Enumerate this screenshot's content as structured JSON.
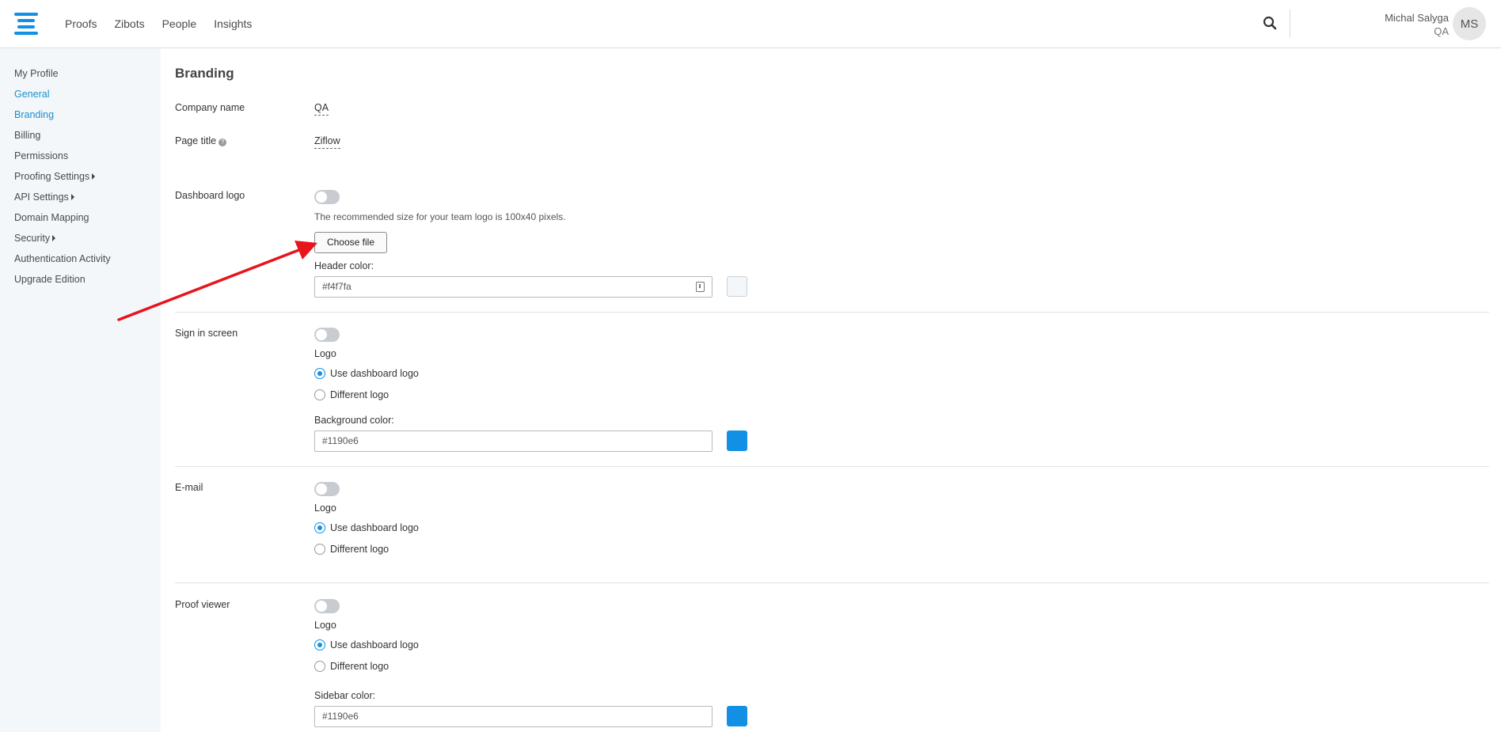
{
  "nav": {
    "links": [
      "Proofs",
      "Zibots",
      "People",
      "Insights"
    ],
    "user_name": "Michal Salyga",
    "user_role": "QA",
    "avatar_initials": "MS",
    "logo_color": "#1190e6"
  },
  "sidebar": {
    "items": [
      {
        "label": "My Profile"
      },
      {
        "label": "General"
      },
      {
        "label": "Branding"
      },
      {
        "label": "Billing"
      },
      {
        "label": "Permissions"
      },
      {
        "label": "Proofing Settings"
      },
      {
        "label": "API Settings"
      },
      {
        "label": "Domain Mapping"
      },
      {
        "label": "Security"
      },
      {
        "label": "Authentication Activity"
      },
      {
        "label": "Upgrade Edition"
      }
    ]
  },
  "branding": {
    "title": "Branding",
    "company_name_label": "Company name",
    "company_name_value": "QA",
    "page_title_label": "Page title",
    "page_title_value": "Ziflow",
    "dashboard": {
      "label": "Dashboard logo",
      "hint": "The recommended size for your team logo is 100x40 pixels.",
      "choose_file": "Choose file",
      "color_label": "Header color:",
      "color_value": "#f4f7fa",
      "color_display": "#f4f7fa"
    },
    "sign_in": {
      "label": "Sign in screen",
      "logo_label": "Logo",
      "option_1": "Use dashboard logo",
      "option_2": "Different logo",
      "color_label": "Background color:",
      "color_value": "#1190e6",
      "color_display": "#1190e6"
    },
    "email": {
      "label": "E-mail",
      "logo_label": "Logo",
      "option_1": "Use dashboard logo",
      "option_2": "Different logo"
    },
    "proof_viewer": {
      "label": "Proof viewer",
      "logo_label": "Logo",
      "option_1": "Use dashboard logo",
      "option_2": "Different logo",
      "color_label": "Sidebar color:",
      "color_value": "#1190e6",
      "color_display": "#1190e6"
    }
  },
  "colors": {
    "accent": "#1190e6",
    "sidebar_bg": "#f4f7fa",
    "active_link": "#1a8fcf",
    "annotation_arrow": "#e8141b"
  }
}
